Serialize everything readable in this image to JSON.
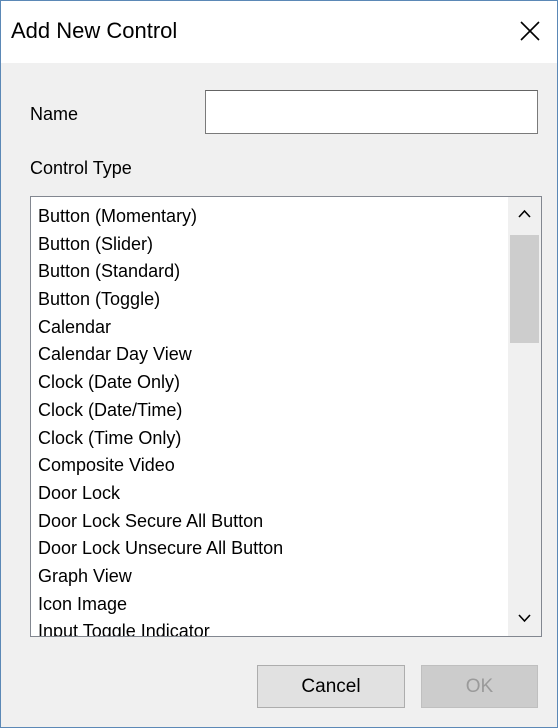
{
  "window": {
    "title": "Add New Control"
  },
  "form": {
    "name_label": "Name",
    "name_value": "",
    "type_label": "Control Type"
  },
  "control_types": [
    "Button (Momentary)",
    "Button (Slider)",
    "Button (Standard)",
    "Button (Toggle)",
    "Calendar",
    "Calendar Day View",
    "Clock (Date Only)",
    "Clock (Date/Time)",
    "Clock (Time Only)",
    "Composite Video",
    "Door Lock",
    "Door Lock Secure All Button",
    "Door Lock Unsecure All Button",
    "Graph View",
    "Icon Image",
    "Input Toggle Indicator"
  ],
  "buttons": {
    "cancel": "Cancel",
    "ok": "OK"
  },
  "icons": {
    "close": "close-icon",
    "scroll_up": "chevron-up-icon",
    "scroll_down": "chevron-down-icon"
  }
}
